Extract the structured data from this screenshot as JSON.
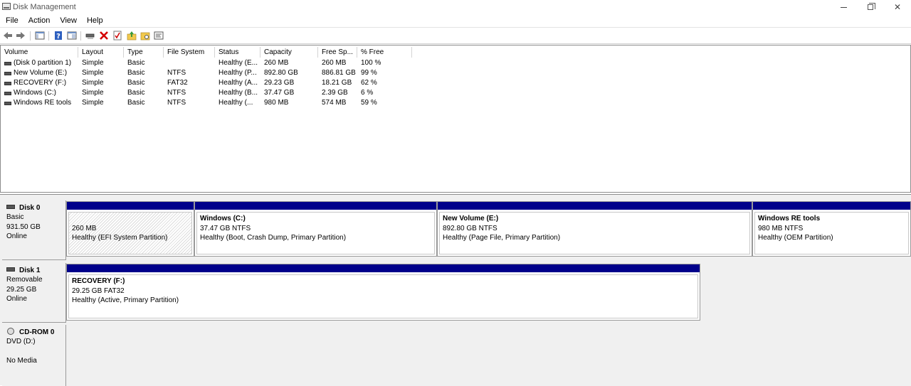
{
  "window": {
    "title": "Disk Management",
    "minimize_glyph": "—",
    "close_glyph": "✕"
  },
  "menu": [
    "File",
    "Action",
    "View",
    "Help"
  ],
  "toolbar": {
    "icons": [
      "back-arrow-icon",
      "forward-arrow-icon",
      "show-hide-console-tree-icon",
      "help-icon",
      "properties-icon",
      "connect-virtual-disk-icon",
      "delete-icon",
      "check-icon",
      "open-folder-icon",
      "explore-folder-icon",
      "settings-panel-icon"
    ],
    "delete_color": "#d40000",
    "help_color": "#2d5fbf"
  },
  "volume_list": {
    "columns": [
      "Volume",
      "Layout",
      "Type",
      "File System",
      "Status",
      "Capacity",
      "Free Sp...",
      "% Free"
    ],
    "rows": [
      [
        "(Disk 0 partition 1)",
        "Simple",
        "Basic",
        "",
        "Healthy (E...",
        "260 MB",
        "260 MB",
        "100 %"
      ],
      [
        "New Volume (E:)",
        "Simple",
        "Basic",
        "NTFS",
        "Healthy (P...",
        "892.80 GB",
        "886.81 GB",
        "99 %"
      ],
      [
        "RECOVERY (F:)",
        "Simple",
        "Basic",
        "FAT32",
        "Healthy (A...",
        "29.23 GB",
        "18.21 GB",
        "62 %"
      ],
      [
        "Windows (C:)",
        "Simple",
        "Basic",
        "NTFS",
        "Healthy (B...",
        "37.47 GB",
        "2.39 GB",
        "6 %"
      ],
      [
        "Windows RE tools",
        "Simple",
        "Basic",
        "NTFS",
        "Healthy (...",
        "980 MB",
        "574 MB",
        "59 %"
      ]
    ]
  },
  "disks": [
    {
      "name": "Disk 0",
      "lines": [
        "Basic",
        "931.50 GB",
        "Online"
      ],
      "partitions": [
        {
          "name": "",
          "size": "260 MB",
          "status": "Healthy (EFI System Partition)"
        },
        {
          "name": "Windows  (C:)",
          "size": "37.47 GB NTFS",
          "status": "Healthy (Boot, Crash Dump, Primary Partition)"
        },
        {
          "name": "New Volume  (E:)",
          "size": "892.80 GB NTFS",
          "status": "Healthy (Page File, Primary Partition)"
        },
        {
          "name": "Windows RE tools",
          "size": "980 MB NTFS",
          "status": "Healthy (OEM Partition)"
        }
      ]
    },
    {
      "name": "Disk 1",
      "lines": [
        "Removable",
        "29.25 GB",
        "Online"
      ],
      "partitions": [
        {
          "name": "RECOVERY  (F:)",
          "size": "29.25 GB FAT32",
          "status": "Healthy (Active, Primary Partition)"
        }
      ]
    },
    {
      "name": "CD-ROM 0",
      "lines": [
        "DVD (D:)",
        "",
        "No Media"
      ],
      "partitions": []
    }
  ],
  "colors": {
    "partition_bar": "#00008b",
    "pane_background": "#f0f0f0"
  }
}
